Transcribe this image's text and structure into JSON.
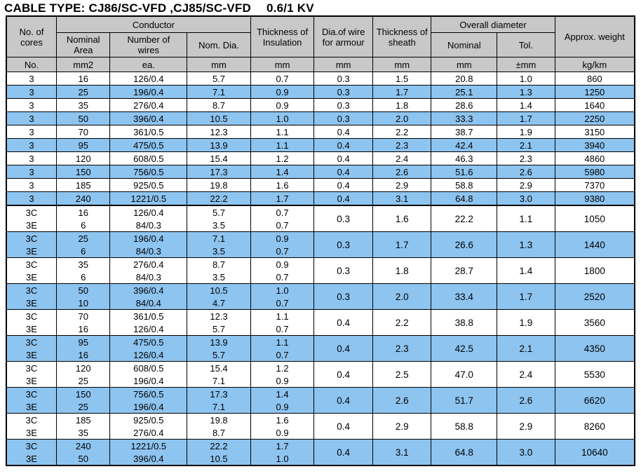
{
  "title": {
    "main": "CABLE TYPE: CJ86/SC-VFD ,CJ85/SC-VFD",
    "voltage": "0.6/1 KV"
  },
  "header": {
    "groups": {
      "cores": "No. of\ncores",
      "cores_l1": "No. of",
      "cores_l2": "cores",
      "conductor": "Conductor",
      "insulation_l1": "Thickness of",
      "insulation_l2": "Insulation",
      "armour_l1": "Dia.of wire",
      "armour_l2": "for armour",
      "sheath_l1": "Thickness of",
      "sheath_l2": "sheath",
      "overall": "Overall diameter",
      "weight": "Approx. weight"
    },
    "sub": {
      "nominal_area_l1": "Nominal",
      "nominal_area_l2": "Area",
      "number_wires_l1": "Number of",
      "number_wires_l2": "wires",
      "nom_dia": "Nom. Dia.",
      "od_nominal": "Nominal",
      "od_tol": "Tol."
    },
    "units": {
      "cores": "No.",
      "area": "mm2",
      "wires": "ea.",
      "dia": "mm",
      "insulation": "mm",
      "armour": "mm",
      "sheath": "mm",
      "od_nominal": "mm",
      "od_tol": "±mm",
      "weight": "kg/km"
    }
  },
  "chart_data": {
    "type": "table",
    "title": "CABLE TYPE: CJ86/SC-VFD ,CJ85/SC-VFD   0.6/1 KV",
    "columns": [
      "No. of cores (No.)",
      "Conductor Nominal Area (mm2)",
      "Conductor Number of wires (ea.)",
      "Conductor Nom. Dia. (mm)",
      "Thickness of Insulation (mm)",
      "Dia.of wire for armour (mm)",
      "Thickness of sheath (mm)",
      "Overall diameter Nominal (mm)",
      "Overall diameter Tol. (±mm)",
      "Approx. weight (kg/km)"
    ]
  },
  "sections": [
    {
      "id": "three-core",
      "rows": [
        {
          "cores": "3",
          "area": "16",
          "wires": "126/0.4",
          "dia": "5.7",
          "ins": "0.7",
          "arm": "0.3",
          "sheath": "1.5",
          "od": "20.8",
          "tol": "1.0",
          "weight": "860"
        },
        {
          "cores": "3",
          "area": "25",
          "wires": "196/0.4",
          "dia": "7.1",
          "ins": "0.9",
          "arm": "0.3",
          "sheath": "1.7",
          "od": "25.1",
          "tol": "1.3",
          "weight": "1250"
        },
        {
          "cores": "3",
          "area": "35",
          "wires": "276/0.4",
          "dia": "8.7",
          "ins": "0.9",
          "arm": "0.3",
          "sheath": "1.8",
          "od": "28.6",
          "tol": "1.4",
          "weight": "1640"
        },
        {
          "cores": "3",
          "area": "50",
          "wires": "396/0.4",
          "dia": "10.5",
          "ins": "1.0",
          "arm": "0.3",
          "sheath": "2.0",
          "od": "33.3",
          "tol": "1.7",
          "weight": "2250"
        },
        {
          "cores": "3",
          "area": "70",
          "wires": "361/0.5",
          "dia": "12.3",
          "ins": "1.1",
          "arm": "0.4",
          "sheath": "2.2",
          "od": "38.7",
          "tol": "1.9",
          "weight": "3150"
        },
        {
          "cores": "3",
          "area": "95",
          "wires": "475/0.5",
          "dia": "13.9",
          "ins": "1.1",
          "arm": "0.4",
          "sheath": "2.3",
          "od": "42.4",
          "tol": "2.1",
          "weight": "3940"
        },
        {
          "cores": "3",
          "area": "120",
          "wires": "608/0.5",
          "dia": "15.4",
          "ins": "1.2",
          "arm": "0.4",
          "sheath": "2.4",
          "od": "46.3",
          "tol": "2.3",
          "weight": "4860"
        },
        {
          "cores": "3",
          "area": "150",
          "wires": "756/0.5",
          "dia": "17.3",
          "ins": "1.4",
          "arm": "0.4",
          "sheath": "2.6",
          "od": "51.6",
          "tol": "2.6",
          "weight": "5980"
        },
        {
          "cores": "3",
          "area": "185",
          "wires": "925/0.5",
          "dia": "19.8",
          "ins": "1.6",
          "arm": "0.4",
          "sheath": "2.9",
          "od": "58.8",
          "tol": "2.9",
          "weight": "7370"
        },
        {
          "cores": "3",
          "area": "240",
          "wires": "1221/0.5",
          "dia": "22.2",
          "ins": "1.7",
          "arm": "0.4",
          "sheath": "3.1",
          "od": "64.8",
          "tol": "3.0",
          "weight": "9380"
        }
      ]
    },
    {
      "id": "three-core-plus-earth",
      "rows": [
        {
          "cores1": "3C",
          "cores2": "3E",
          "area1": "16",
          "area2": "6",
          "wires1": "126/0.4",
          "wires2": "84/0.3",
          "dia1": "5.7",
          "dia2": "3.5",
          "ins1": "0.7",
          "ins2": "0.7",
          "arm": "0.3",
          "sheath": "1.6",
          "od": "22.2",
          "tol": "1.1",
          "weight": "1050"
        },
        {
          "cores1": "3C",
          "cores2": "3E",
          "area1": "25",
          "area2": "6",
          "wires1": "196/0.4",
          "wires2": "84/0.3",
          "dia1": "7.1",
          "dia2": "3.5",
          "ins1": "0.9",
          "ins2": "0.7",
          "arm": "0.3",
          "sheath": "1.7",
          "od": "26.6",
          "tol": "1.3",
          "weight": "1440"
        },
        {
          "cores1": "3C",
          "cores2": "3E",
          "area1": "35",
          "area2": "6",
          "wires1": "276/0.4",
          "wires2": "84/0.3",
          "dia1": "8.7",
          "dia2": "3.5",
          "ins1": "0.9",
          "ins2": "0.7",
          "arm": "0.3",
          "sheath": "1.8",
          "od": "28.7",
          "tol": "1.4",
          "weight": "1800"
        },
        {
          "cores1": "3C",
          "cores2": "3E",
          "area1": "50",
          "area2": "10",
          "wires1": "396/0.4",
          "wires2": "84/0.4",
          "dia1": "10.5",
          "dia2": "4.7",
          "ins1": "1.0",
          "ins2": "0.7",
          "arm": "0.3",
          "sheath": "2.0",
          "od": "33.4",
          "tol": "1.7",
          "weight": "2520"
        },
        {
          "cores1": "3C",
          "cores2": "3E",
          "area1": "70",
          "area2": "16",
          "wires1": "361/0.5",
          "wires2": "126/0.4",
          "dia1": "12.3",
          "dia2": "5.7",
          "ins1": "1.1",
          "ins2": "0.7",
          "arm": "0.4",
          "sheath": "2.2",
          "od": "38.8",
          "tol": "1.9",
          "weight": "3560"
        },
        {
          "cores1": "3C",
          "cores2": "3E",
          "area1": "95",
          "area2": "16",
          "wires1": "475/0.5",
          "wires2": "126/0.4",
          "dia1": "13.9",
          "dia2": "5.7",
          "ins1": "1.1",
          "ins2": "0.7",
          "arm": "0.4",
          "sheath": "2.3",
          "od": "42.5",
          "tol": "2.1",
          "weight": "4350"
        },
        {
          "cores1": "3C",
          "cores2": "3E",
          "area1": "120",
          "area2": "25",
          "wires1": "608/0.5",
          "wires2": "196/0.4",
          "dia1": "15.4",
          "dia2": "7.1",
          "ins1": "1.2",
          "ins2": "0.9",
          "arm": "0.4",
          "sheath": "2.5",
          "od": "47.0",
          "tol": "2.4",
          "weight": "5530"
        },
        {
          "cores1": "3C",
          "cores2": "3E",
          "area1": "150",
          "area2": "25",
          "wires1": "756/0.5",
          "wires2": "196/0.4",
          "dia1": "17.3",
          "dia2": "7.1",
          "ins1": "1.4",
          "ins2": "0.9",
          "arm": "0.4",
          "sheath": "2.6",
          "od": "51.7",
          "tol": "2.6",
          "weight": "6620"
        },
        {
          "cores1": "3C",
          "cores2": "3E",
          "area1": "185",
          "area2": "35",
          "wires1": "925/0.5",
          "wires2": "276/0.4",
          "dia1": "19.8",
          "dia2": "8.7",
          "ins1": "1.6",
          "ins2": "0.9",
          "arm": "0.4",
          "sheath": "2.9",
          "od": "58.8",
          "tol": "2.9",
          "weight": "8260"
        },
        {
          "cores1": "3C",
          "cores2": "3E",
          "area1": "240",
          "area2": "50",
          "wires1": "1221/0.5",
          "wires2": "396/0.4",
          "dia1": "22.2",
          "dia2": "10.5",
          "ins1": "1.7",
          "ins2": "1.0",
          "arm": "0.4",
          "sheath": "3.1",
          "od": "64.8",
          "tol": "3.0",
          "weight": "10640"
        }
      ]
    }
  ],
  "colors": {
    "header_gray": "#c8c8c8",
    "row_blue": "#8ec4f0",
    "row_white": "#ffffff",
    "border": "#000000"
  }
}
